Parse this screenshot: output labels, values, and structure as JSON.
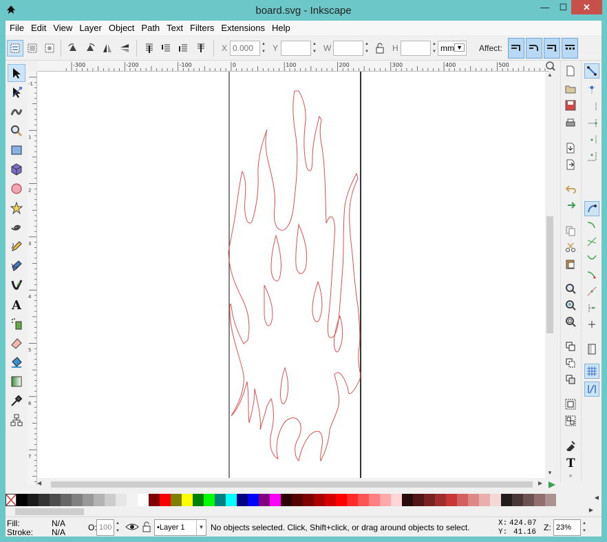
{
  "window": {
    "title": "board.svg - Inkscape",
    "controls": {
      "minimize": "—",
      "maximize": "☐",
      "close": "✕"
    }
  },
  "menu": [
    "File",
    "Edit",
    "View",
    "Layer",
    "Object",
    "Path",
    "Text",
    "Filters",
    "Extensions",
    "Help"
  ],
  "toolbar": {
    "x_label": "X",
    "x_value": "0.000",
    "y_label": "Y",
    "y_value": "",
    "w_label": "W",
    "w_value": "",
    "h_label": "H",
    "h_value": "",
    "unit": "mm",
    "affect_label": "Affect:"
  },
  "ruler": {
    "top_ticks": [
      "-300",
      "-200",
      "-100",
      "0",
      "100",
      "200",
      "300",
      "400",
      "500"
    ],
    "left_ticks": [
      "-1",
      "1",
      "2",
      "3",
      "4",
      "5",
      "6",
      "7",
      "8"
    ]
  },
  "palette": {
    "colors": [
      "#000000",
      "#1a1a1a",
      "#333333",
      "#4d4d4d",
      "#666666",
      "#808080",
      "#999999",
      "#b3b3b3",
      "#cccccc",
      "#e6e6e6",
      "#f2f2f2",
      "#ffffff",
      "#800000",
      "#ff0000",
      "#808000",
      "#ffff00",
      "#008000",
      "#00ff00",
      "#008080",
      "#00ffff",
      "#000080",
      "#0000ff",
      "#800080",
      "#ff00ff",
      "#2b0000",
      "#550000",
      "#800000",
      "#aa0000",
      "#d40000",
      "#ff0000",
      "#ff2a2a",
      "#ff5555",
      "#ff8080",
      "#ffaaaa",
      "#ffd5d5",
      "#280b0b",
      "#501616",
      "#782121",
      "#a02c2c",
      "#c83737",
      "#d35f5f",
      "#de8787",
      "#e9afaf",
      "#f4d7d7",
      "#241c1c",
      "#483737",
      "#6c5353",
      "#916f6f",
      "#ac9393"
    ]
  },
  "status": {
    "fill_label": "Fill:",
    "fill_value": "N/A",
    "stroke_label": "Stroke:",
    "stroke_value": "N/A",
    "opacity_label": "O:",
    "opacity_value": "100",
    "layer": "•Layer 1",
    "message": "No objects selected. Click, Shift+click, or drag around objects to select.",
    "x_label": "X:",
    "x_value": "424.07",
    "y_label": "Y:",
    "y_value": "41.16",
    "zoom_label": "Z:",
    "zoom_value": "23%"
  },
  "icons": {
    "left_tools": [
      "selector-icon",
      "node-icon",
      "tweak-icon",
      "zoom-icon",
      "rectangle-icon",
      "box3d-icon",
      "ellipse-icon",
      "star-icon",
      "spiral-icon",
      "pencil-icon",
      "pen-icon",
      "calligraphy-icon",
      "text-icon",
      "spray-icon",
      "eraser-icon",
      "bucket-icon",
      "gradient-icon",
      "dropper-icon",
      "connector-icon"
    ],
    "colors": {
      "accent": "#6cc7c9",
      "flame_stroke": "#e05050",
      "active_bg": "#cde4f7"
    }
  }
}
